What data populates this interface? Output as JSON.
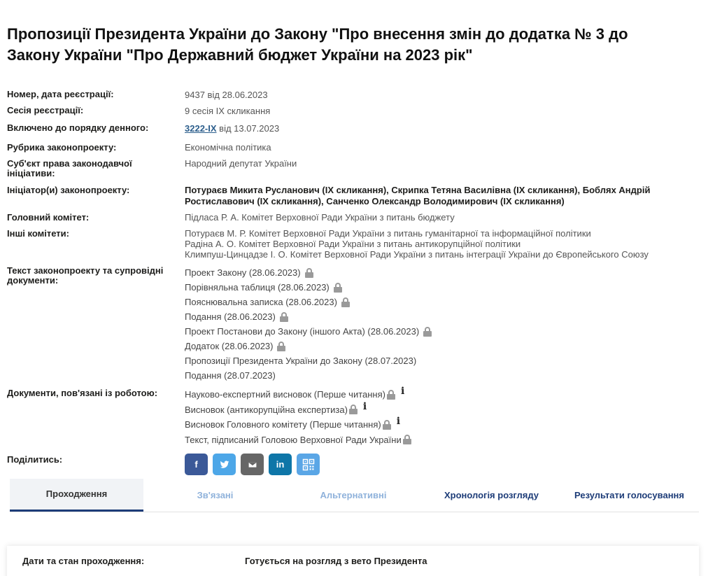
{
  "title": "Пропозиції Президента України до Закону \"Про внесення змін до додатка № 3 до Закону України \"Про Державний бюджет України на 2023 рік\"",
  "fields": {
    "reg": {
      "label": "Номер, дата реєстрації:",
      "value": "9437 від 28.06.2023"
    },
    "session": {
      "label": "Сесія реєстрації:",
      "value": "9 сесія IX скликання"
    },
    "agenda": {
      "label": "Включено до порядку денного:",
      "link": "3222-IX",
      "rest": " від 13.07.2023"
    },
    "rubric": {
      "label": "Рубрика законопроекту:",
      "value": "Економічна політика"
    },
    "subject": {
      "label": "Суб'єкт права законодавчої ініціативи:",
      "value": "Народний депутат України"
    },
    "initiators": {
      "label": "Ініціатор(и) законопроекту:",
      "value": "Потураєв Микита Русланович (IX скликання), Скрипка Тетяна Василівна (IX скликання), Боблях Андрій Ростиславович (IX скликання), Санченко Олександр Володимирович (IX скликання)"
    },
    "main_committee": {
      "label": "Головний комітет:",
      "value": "Підласа Р. А. Комітет Верховної Ради України з питань бюджету"
    },
    "other_committees": {
      "label": "Інші комітети:",
      "values": [
        "Потураєв М. Р. Комітет Верховної Ради України з питань гуманітарної та інформаційної політики",
        "Радіна А. О. Комітет Верховної Ради України з питань антикорупційної політики",
        "Климпуш-Цинцадзе І. О. Комітет Верховної Ради України з питань інтеграції України до Європейського Союзу"
      ]
    },
    "docs": {
      "label": "Текст законопроекту та супровідні документи:",
      "items": [
        "Проект Закону (28.06.2023)",
        "Порівняльна таблиця (28.06.2023)",
        "Пояснювальна записка (28.06.2023)",
        "Подання (28.06.2023)",
        "Проект Постанови до Закону (іншого Акта) (28.06.2023)",
        "Додаток (28.06.2023)",
        "Пропозиції Президента України до Закону (28.07.2023)",
        "Подання (28.07.2023)"
      ]
    },
    "work_docs": {
      "label": "Документи, пов'язані із роботою:",
      "items": [
        "Науково-експертний висновок (Перше читання)",
        "Висновок (антикорупційна експертиза)",
        "Висновок Головного комітету (Перше читання)",
        "Текст, підписаний Головою Верховної Ради України"
      ]
    },
    "share": {
      "label": "Поділитись:"
    }
  },
  "share_buttons": {
    "facebook": "f",
    "twitter": "twitter-icon",
    "email": "email-icon",
    "linkedin": "in",
    "qr": "qr-icon"
  },
  "tabs": [
    "Проходження",
    "Зв'язані",
    "Альтернативні",
    "Хронологія розгляду",
    "Результати голосування"
  ],
  "panel": {
    "label": "Дати та стан проходження:",
    "value": "Готується на розгляд з вето Президента"
  },
  "colors": {
    "accent": "#1d3c78",
    "link": "#2c5e8c",
    "facebook": "#3b5998",
    "twitter": "#4da7e8",
    "email": "#666666",
    "linkedin": "#0e76a8",
    "qr": "#5aa6e6"
  }
}
